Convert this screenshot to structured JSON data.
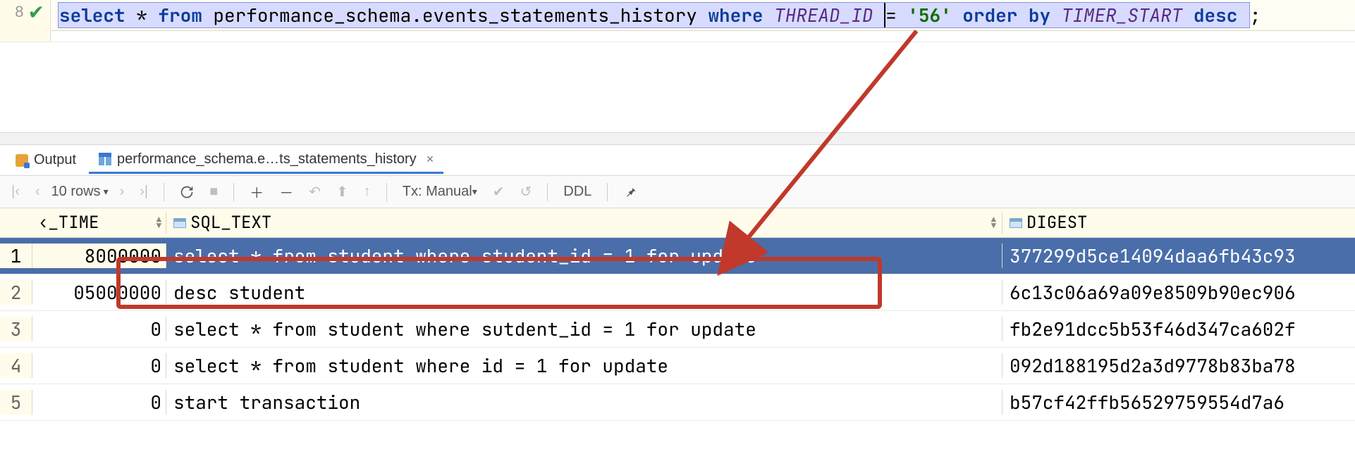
{
  "gutter": {
    "line_no": "8"
  },
  "sql": {
    "kw_select": "select",
    "star": " * ",
    "kw_from": "from",
    "table": " performance_schema.events_statements_history ",
    "kw_where": "where",
    "col_thread": " THREAD_ID ",
    "eq": "= ",
    "val": "'56'",
    "kw_order": " order by",
    "col_timer": " TIMER_START ",
    "kw_desc": "desc",
    "semi": ";"
  },
  "tabs": {
    "output": "Output",
    "result": "performance_schema.e…ts_statements_history",
    "close": "×"
  },
  "toolbar": {
    "rows_label": "10 rows",
    "tx_label": "Tx: Manual",
    "ddl": "DDL"
  },
  "headers": {
    "time": "‹_TIME",
    "sql": "SQL_TEXT",
    "digest": "DIGEST"
  },
  "rows": [
    {
      "n": "1",
      "time": "8000000",
      "sql": "select * from student where student_id = 1 for update",
      "digest": "377299d5ce14094daa6fb43c93"
    },
    {
      "n": "2",
      "time": "05000000",
      "sql": "desc student",
      "digest": "6c13c06a69a09e8509b90ec906"
    },
    {
      "n": "3",
      "time": "0",
      "sql": "select * from student where sutdent_id = 1 for update",
      "digest": "fb2e91dcc5b53f46d347ca602f"
    },
    {
      "n": "4",
      "time": "0",
      "sql": "select * from student where id = 1 for update",
      "digest": "092d188195d2a3d9778b83ba78"
    },
    {
      "n": "5",
      "time": "0",
      "sql": "start transaction",
      "digest": "b57cf42ffb56529759554d7a6"
    }
  ]
}
